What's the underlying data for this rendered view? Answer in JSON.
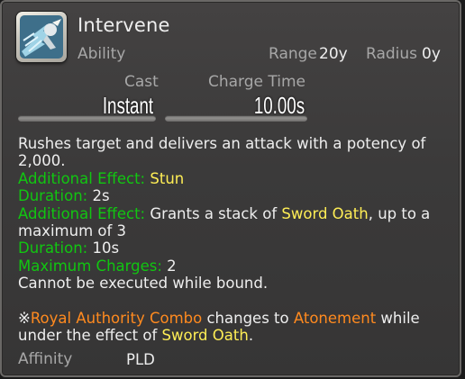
{
  "action": {
    "name": "Intervene",
    "type": "Ability",
    "icon": "intervene-dash-icon"
  },
  "range": {
    "label": "Range",
    "value": "20y"
  },
  "radius": {
    "label": "Radius",
    "value": "0y"
  },
  "cast": {
    "label": "Cast",
    "value": "Instant"
  },
  "charge": {
    "label": "Charge Time",
    "value": "10.00s"
  },
  "description": {
    "line1": "Rushes target and delivers an attack with a potency of",
    "line2": "2,000.",
    "effect1_label": "Additional Effect:",
    "effect1_value": "Stun",
    "duration1_label": "Duration:",
    "duration1_value": "2s",
    "effect2_label": "Additional Effect:",
    "effect2_pre": "Grants a stack of",
    "effect2_status": "Sword Oath",
    "effect2_post": ", up to a",
    "effect2_line2": "maximum of 3",
    "duration2_label": "Duration:",
    "duration2_value": "10s",
    "charges_label": "Maximum Charges:",
    "charges_value": "2",
    "restriction": "Cannot be executed while bound.",
    "note_mark": "※",
    "combo_action": "Royal Authority Combo",
    "note_mid": " changes to ",
    "combo_result": "Atonement",
    "note_post": " while",
    "note_line2_pre": "under the effect of ",
    "note_status": "Sword Oath",
    "note_line2_post": "."
  },
  "affinity": {
    "label": "Affinity",
    "value": "PLD"
  },
  "colors": {
    "label_grey": "#a7a7a7",
    "text": "#eeeeee",
    "green": "#11c611",
    "yellow": "#ffee55",
    "orange": "#ff8a1f"
  }
}
